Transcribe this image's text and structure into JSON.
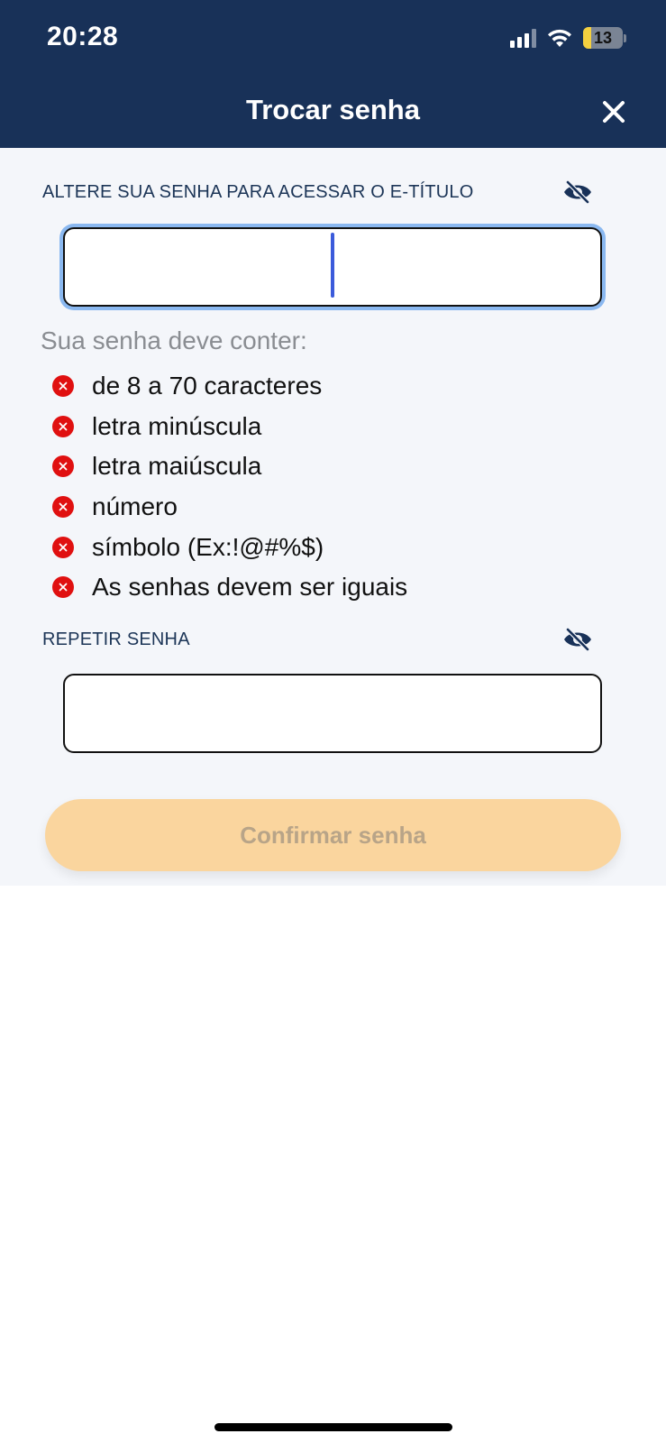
{
  "status_bar": {
    "time": "20:28",
    "battery_level": "13",
    "icons": [
      "signal-icon",
      "wifi-icon",
      "battery-icon"
    ]
  },
  "header": {
    "title": "Trocar senha",
    "close_icon": "close-icon",
    "background_color": "#183158"
  },
  "password_field": {
    "label": "ALTERE SUA SENHA PARA ACESSAR O E-TÍTULO",
    "value": "",
    "visibility_icon": "eye-slash-icon",
    "focused": true
  },
  "requirements": {
    "heading": "Sua senha deve conter:",
    "status_icon": "error-x-icon",
    "status_color": "#e01010",
    "items": [
      {
        "label": "de 8 a 70 caracteres",
        "met": false
      },
      {
        "label": "letra minúscula",
        "met": false
      },
      {
        "label": "letra maiúscula",
        "met": false
      },
      {
        "label": "número",
        "met": false
      },
      {
        "label": "símbolo (Ex:!@#%$)",
        "met": false
      },
      {
        "label": "As senhas devem ser iguais",
        "met": false
      }
    ]
  },
  "repeat_field": {
    "label": "REPETIR SENHA",
    "value": "",
    "visibility_icon": "eye-slash-icon"
  },
  "confirm_button": {
    "label": "Confirmar senha",
    "enabled": false,
    "color": "#fad59e"
  }
}
